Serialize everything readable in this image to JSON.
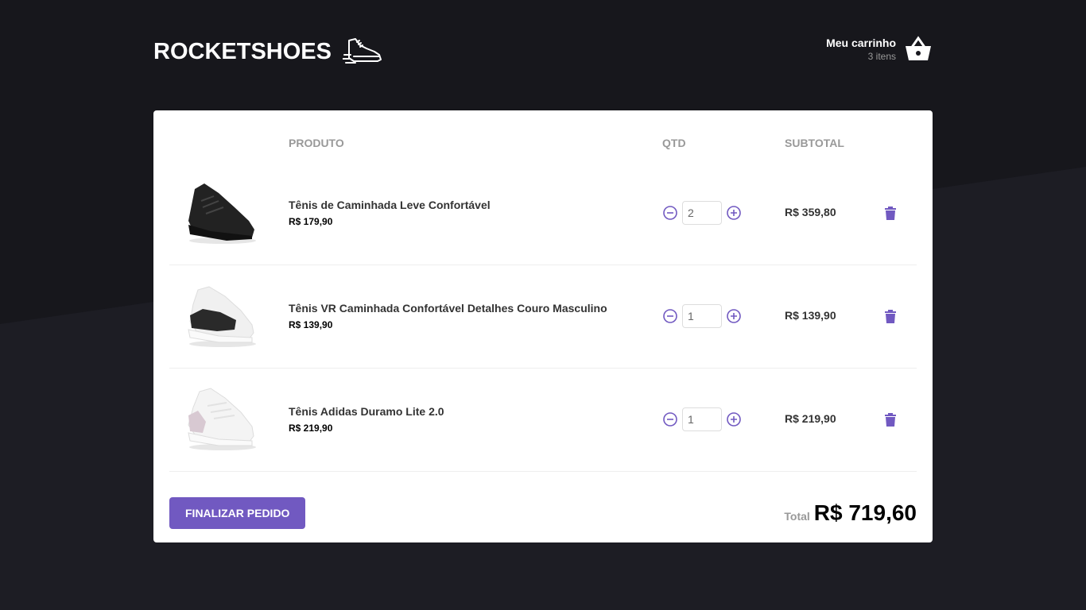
{
  "header": {
    "brand": "ROCKETSHOES",
    "brand_icon": "running-shoe-icon",
    "cart_title": "Meu carrinho",
    "cart_count": "3 itens",
    "cart_icon": "basket-icon"
  },
  "table": {
    "headers": [
      "PRODUTO",
      "QTD",
      "SUBTOTAL"
    ],
    "rows": [
      {
        "name": "Tênis de Caminhada Leve Confortável",
        "price": "R$ 179,90",
        "qty": "2",
        "subtotal": "R$ 359,80",
        "shoe_color": "#222222"
      },
      {
        "name": "Tênis VR Caminhada Confortável Detalhes Couro Masculino",
        "price": "R$ 139,90",
        "qty": "1",
        "subtotal": "R$ 139,90",
        "shoe_color": "#2a2a2a"
      },
      {
        "name": "Tênis Adidas Duramo Lite 2.0",
        "price": "R$ 219,90",
        "qty": "1",
        "subtotal": "R$ 219,90",
        "shoe_color": "#f2f2f2"
      }
    ]
  },
  "footer": {
    "finish_label": "FINALIZAR PEDIDO",
    "total_label": "Total",
    "total_value": "R$ 719,60"
  },
  "colors": {
    "accent": "#7159c1",
    "background": "#191920"
  }
}
